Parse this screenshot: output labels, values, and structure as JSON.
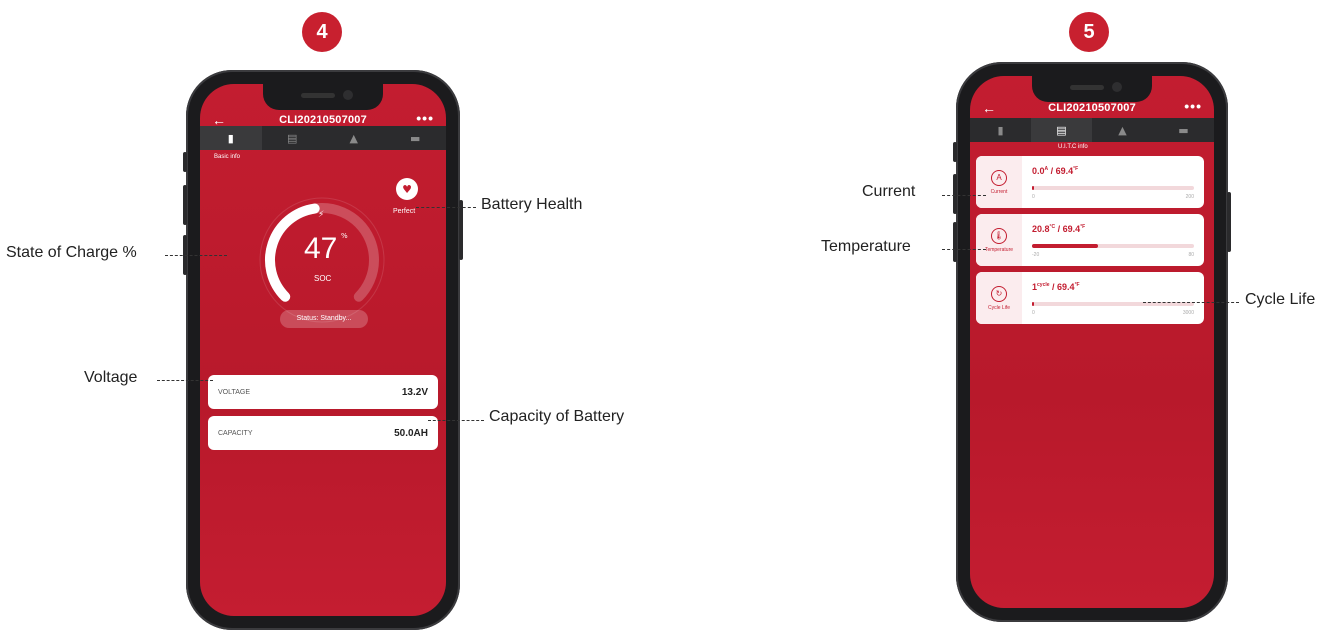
{
  "steps": {
    "left": "4",
    "right": "5"
  },
  "left_phone": {
    "device_id": "CLI20210507007",
    "back_icon": "arrow-left-icon",
    "more_icon": "more-dots-icon",
    "tabs": [
      "battery",
      "report",
      "alarm",
      "cart"
    ],
    "active_tab_caption": "Basic info",
    "soc_value": "47",
    "soc_unit": "%",
    "soc_label": "SOC",
    "soc_fraction": 0.47,
    "health_label": "Perfect",
    "status_text": "Status: Standby...",
    "voltage_label": "VOLTAGE",
    "voltage_value": "13.2V",
    "capacity_label": "CAPACITY",
    "capacity_value": "50.0AH"
  },
  "right_phone": {
    "device_id": "CLI20210507007",
    "active_tab_caption": "U.I.T.C info",
    "current": {
      "caption": "Current",
      "value": "0.0",
      "unit": "A",
      "sep": " / 69.4",
      "unit2": "°F",
      "min": "0",
      "max": "200",
      "fraction": 0.0
    },
    "temperature": {
      "caption": "Temperature",
      "value": "20.8",
      "unit": "°C",
      "sep": " / 69.4",
      "unit2": "°F",
      "min": "-20",
      "max": "80",
      "fraction": 0.41
    },
    "cycle": {
      "caption": "Cycle Life",
      "value": "1",
      "unit": "cycle",
      "sep": " / 69.4",
      "unit2": "°F",
      "min": "0",
      "max": "3000",
      "fraction": 0.01
    }
  },
  "annotations": {
    "state_of_charge": "State of Charge %",
    "voltage": "Voltage",
    "battery_health": "Battery Health",
    "capacity": "Capacity of Battery",
    "current": "Current",
    "temperature": "Temperature",
    "cycle_life": "Cycle Life"
  },
  "colors": {
    "accent": "#c31d30",
    "phone_body": "#1b1b1d",
    "tabbar": "#2b2b2d"
  }
}
